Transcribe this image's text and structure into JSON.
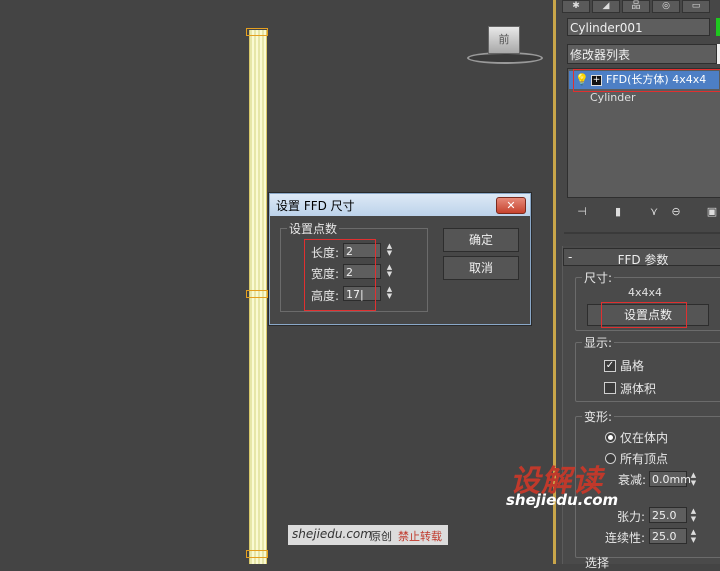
{
  "viewport": {
    "viewcube_label": "前"
  },
  "command_panel": {
    "object_name": "Cylinder001",
    "modifier_list_label": "修改器列表",
    "stack": {
      "items": [
        "FFD(长方体) 4x4x4",
        "Cylinder"
      ]
    },
    "ffd_rollout": {
      "title": "FFD 参数",
      "dimensions_group": "尺寸:",
      "dimensions_value": "4x4x4",
      "set_points_button": "设置点数",
      "display_group": "显示:",
      "lattice_label": "晶格",
      "lattice_checked": true,
      "source_volume_label": "源体积",
      "source_volume_checked": false,
      "deform_group": "变形:",
      "only_in_volume_label": "仅在体内",
      "all_vertices_label": "所有顶点",
      "falloff_label": "衰减:",
      "falloff_value": "0.0mm",
      "tension_label": "张力:",
      "tension_value": "25.0",
      "continuity_label": "连续性:",
      "continuity_value": "25.0",
      "selection_group": "选择"
    }
  },
  "dialog": {
    "title": "设置 FFD 尺寸",
    "close_glyph": "✕",
    "group_title": "设置点数",
    "length_label": "长度:",
    "length_value": "2",
    "width_label": "宽度:",
    "width_value": "2",
    "height_label": "高度:",
    "height_value": "17|",
    "ok_button": "确定",
    "cancel_button": "取消"
  },
  "watermark": {
    "site_text": "shejiedu.com",
    "original_text": "原创",
    "forbid_text": "禁止转载",
    "logo_text": "设解读",
    "logo_url": "shejiedu.com"
  },
  "colors": {
    "accent_selection": "#4d7fc5",
    "highlight_outline": "#e03030",
    "viewport_border": "#c9a64a"
  },
  "icons": [
    "lightbulb-icon",
    "plus-box-icon",
    "pin-icon",
    "show-end-result-icon",
    "make-unique-icon",
    "remove-modifier-icon",
    "configure-sets-icon",
    "close-icon",
    "spinner-arrows-icon"
  ]
}
